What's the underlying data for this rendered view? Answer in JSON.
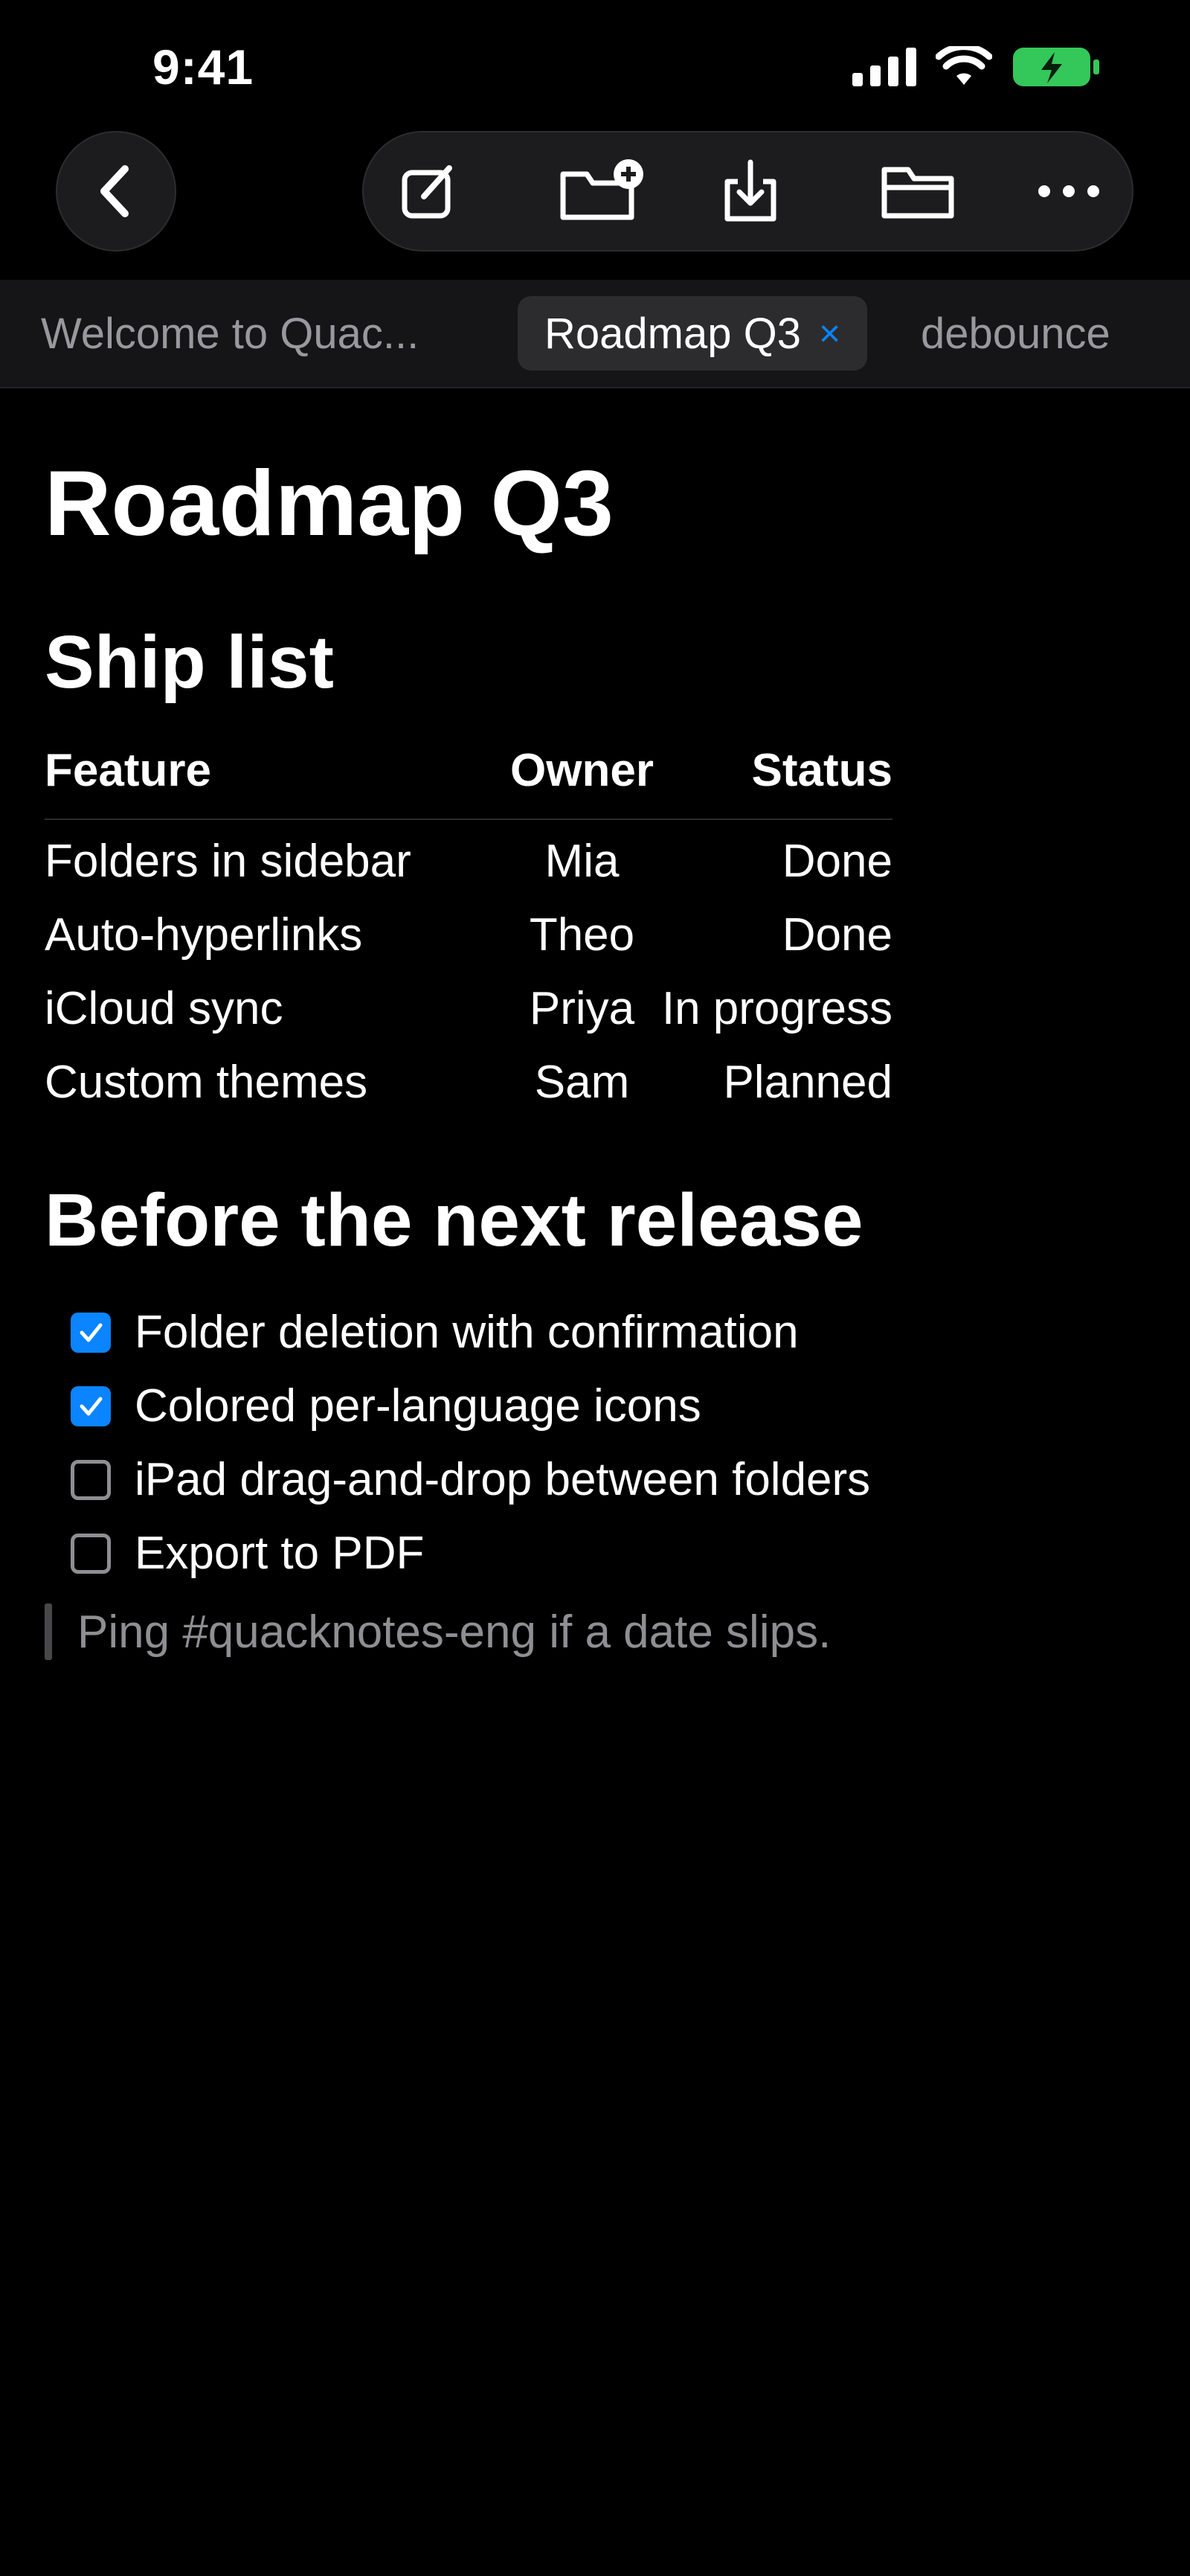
{
  "status_bar": {
    "time": "9:41"
  },
  "tabs": [
    {
      "label": "Welcome to Quac...",
      "active": false
    },
    {
      "label": "Roadmap Q3",
      "active": true,
      "close": "×"
    },
    {
      "label": "debounce",
      "active": false
    }
  ],
  "document": {
    "title": "Roadmap Q3",
    "ship_list": {
      "heading": "Ship list",
      "columns": [
        "Feature",
        "Owner",
        "Status"
      ],
      "rows": [
        [
          "Folders in sidebar",
          "Mia",
          "Done"
        ],
        [
          "Auto-hyperlinks",
          "Theo",
          "Done"
        ],
        [
          "iCloud sync",
          "Priya",
          "In progress"
        ],
        [
          "Custom themes",
          "Sam",
          "Planned"
        ]
      ]
    },
    "release": {
      "heading": "Before the next release",
      "items": [
        {
          "label": "Folder deletion with confirmation",
          "checked": true
        },
        {
          "label": "Colored per-language icons",
          "checked": true
        },
        {
          "label": "iPad drag-and-drop between folders",
          "checked": false
        },
        {
          "label": "Export to PDF",
          "checked": false
        }
      ]
    },
    "quote": "Ping #quacknotes-eng if a date slips."
  },
  "icons": {
    "back": "chevron-left-icon",
    "toolbar": [
      "compose-icon",
      "new-folder-icon",
      "download-icon",
      "folder-icon",
      "more-icon"
    ]
  },
  "colors": {
    "accent": "#0a84ff",
    "battery": "#34c759",
    "background": "#000000"
  }
}
